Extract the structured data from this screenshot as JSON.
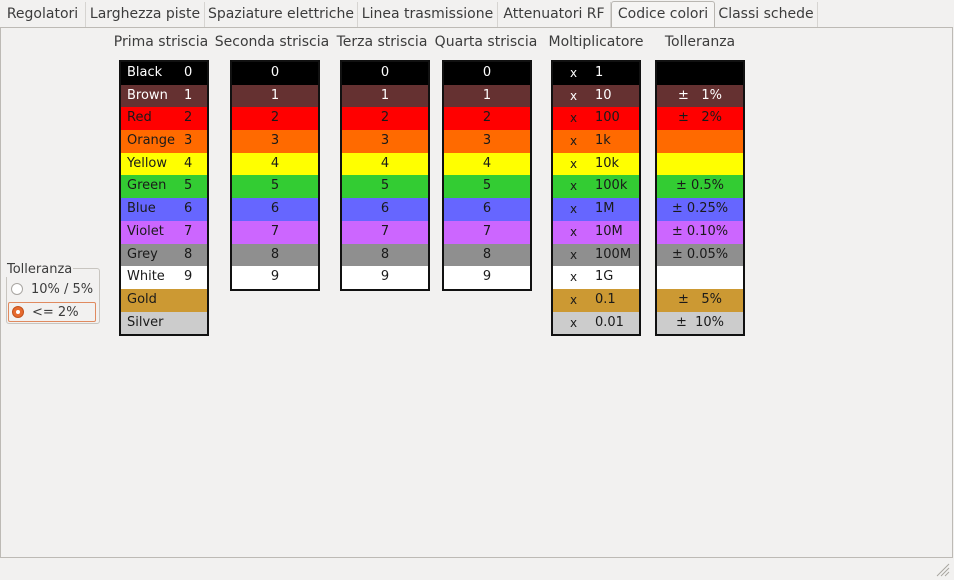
{
  "tabs": [
    {
      "label": "Regolatori",
      "active": false
    },
    {
      "label": "Larghezza piste",
      "active": false
    },
    {
      "label": "Spaziature elettriche",
      "active": false
    },
    {
      "label": "Linea trasmissione",
      "active": false
    },
    {
      "label": "Attenuatori RF",
      "active": false
    },
    {
      "label": "Codice colori",
      "active": true
    },
    {
      "label": "Classi schede",
      "active": false
    }
  ],
  "columns": {
    "first_band": "Prima striscia",
    "second_band": "Seconda striscia",
    "third_band": "Terza striscia",
    "fourth_band": "Quarta striscia",
    "multiplier": "Moltiplicatore",
    "tolerance": "Tolleranza"
  },
  "colors": {
    "black": "#000000",
    "brown": "#653131",
    "red": "#ff0000",
    "orange": "#ff6a00",
    "yellow": "#ffff00",
    "green": "#33cc33",
    "blue": "#6666ff",
    "violet": "#cc66ff",
    "grey": "#8f8f8f",
    "white": "#ffffff",
    "gold": "#cc9933",
    "silver": "#cccccc",
    "radio_accent": "#e66a2e"
  },
  "first_band": [
    {
      "name": "Black",
      "digit": "0"
    },
    {
      "name": "Brown",
      "digit": "1"
    },
    {
      "name": "Red",
      "digit": "2"
    },
    {
      "name": "Orange",
      "digit": "3"
    },
    {
      "name": "Yellow",
      "digit": "4"
    },
    {
      "name": "Green",
      "digit": "5"
    },
    {
      "name": "Blue",
      "digit": "6"
    },
    {
      "name": "Violet",
      "digit": "7"
    },
    {
      "name": "Grey",
      "digit": "8"
    },
    {
      "name": "White",
      "digit": "9"
    },
    {
      "name": "Gold",
      "digit": ""
    },
    {
      "name": "Silver",
      "digit": ""
    }
  ],
  "digit_bands": [
    "0",
    "1",
    "2",
    "3",
    "4",
    "5",
    "6",
    "7",
    "8",
    "9"
  ],
  "multiplier": [
    {
      "x": "x",
      "value": "1"
    },
    {
      "x": "x",
      "value": "10"
    },
    {
      "x": "x",
      "value": "100"
    },
    {
      "x": "x",
      "value": "1k"
    },
    {
      "x": "x",
      "value": "10k"
    },
    {
      "x": "x",
      "value": "100k"
    },
    {
      "x": "x",
      "value": "1M"
    },
    {
      "x": "x",
      "value": "10M"
    },
    {
      "x": "x",
      "value": "100M"
    },
    {
      "x": "x",
      "value": "1G"
    },
    {
      "x": "x",
      "value": "0.1"
    },
    {
      "x": "x",
      "value": "0.01"
    }
  ],
  "tolerance": [
    "",
    "±   1%",
    "±   2%",
    "",
    "",
    "± 0.5%",
    "± 0.25%",
    "± 0.10%",
    "± 0.05%",
    "",
    "±   5%",
    "±  10%"
  ],
  "tolerance_group": {
    "title": "Tolleranza",
    "options": [
      {
        "label": "10% / 5%",
        "selected": false
      },
      {
        "label": "<= 2%",
        "selected": true
      }
    ]
  }
}
